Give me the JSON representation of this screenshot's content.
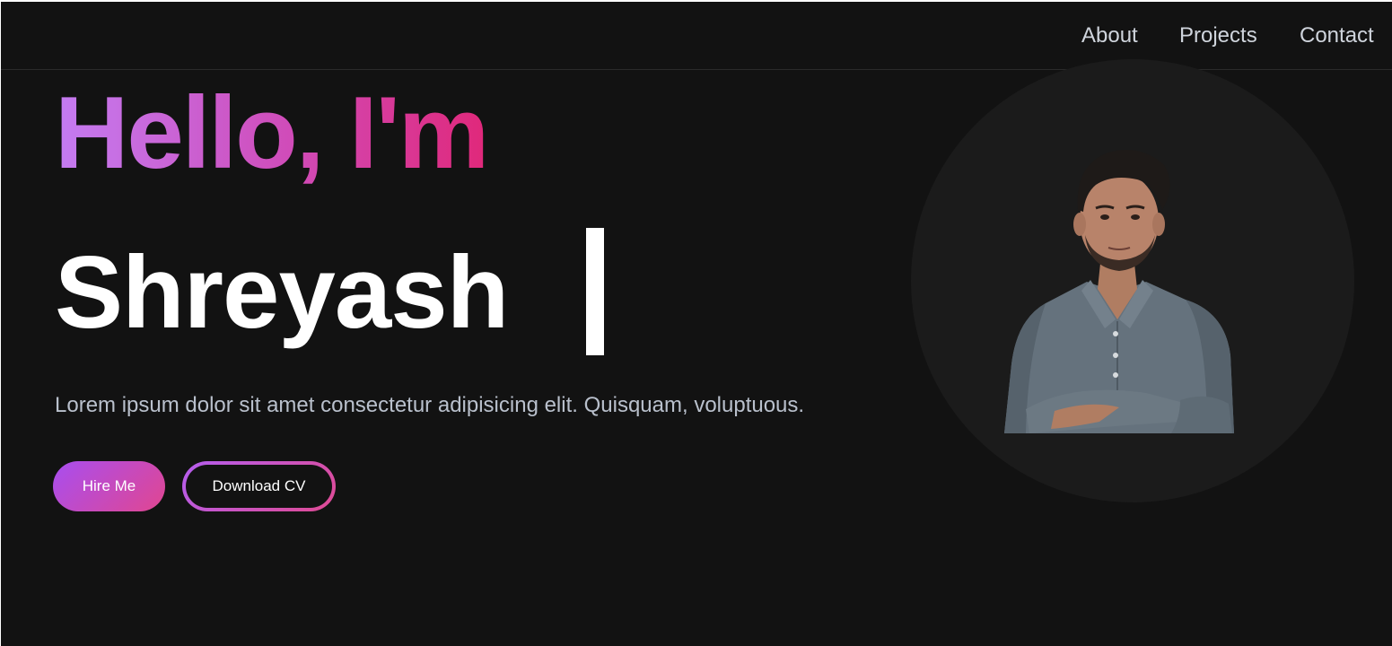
{
  "nav": {
    "links": [
      "About",
      "Projects",
      "Contact"
    ]
  },
  "hero": {
    "greeting": "Hello, I'm",
    "name": "Shreyash",
    "tagline": "Lorem ipsum dolor sit amet consectetur adipisicing elit. Quisquam, voluptuous.",
    "buttons": {
      "hire": "Hire Me",
      "cv": "Download CV"
    },
    "photo_icon": "profile-photo"
  },
  "colors": {
    "background": "#121212",
    "gradient_start": "#a84ef0",
    "gradient_end": "#e14690",
    "nav_text": "#cfd4dc"
  }
}
